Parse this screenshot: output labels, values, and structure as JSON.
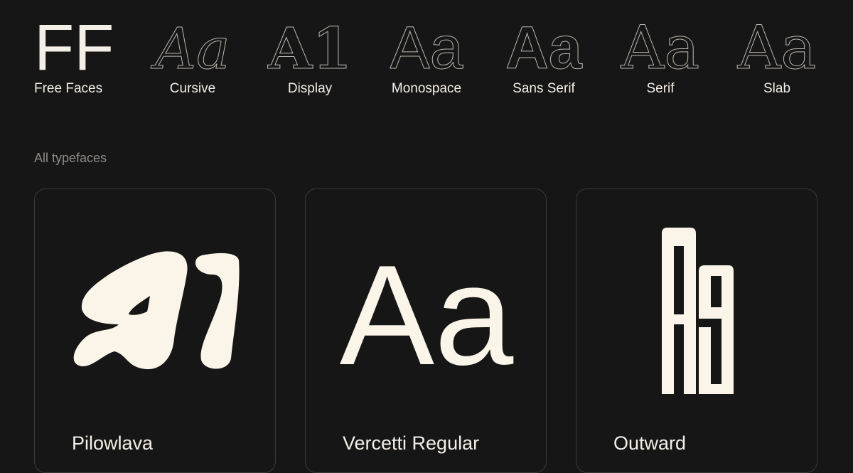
{
  "nav": {
    "brand": {
      "mark": "FF",
      "label": "Free Faces",
      "icon": "ff-logo-icon"
    },
    "categories": [
      {
        "label": "Cursive",
        "sample": "Aa",
        "icon": "cursive-sample-icon"
      },
      {
        "label": "Display",
        "sample": "A1",
        "icon": "display-sample-icon"
      },
      {
        "label": "Monospace",
        "sample": "Aa",
        "icon": "monospace-sample-icon"
      },
      {
        "label": "Sans Serif",
        "sample": "Aa",
        "icon": "sans-serif-sample-icon"
      },
      {
        "label": "Serif",
        "sample": "Aa",
        "icon": "serif-sample-icon"
      },
      {
        "label": "Slab",
        "sample": "Aa",
        "icon": "slab-sample-icon"
      }
    ]
  },
  "section": {
    "label": "All typefaces"
  },
  "cards": [
    {
      "name": "Pilowlava",
      "sample": "A1"
    },
    {
      "name": "Vercetti Regular",
      "sample": "Aa"
    },
    {
      "name": "Outward",
      "sample": "Aa"
    }
  ],
  "colors": {
    "background": "#161616",
    "foreground": "#f4efe6",
    "muted": "#8f8b86",
    "card_border": "#3a3a3a"
  }
}
